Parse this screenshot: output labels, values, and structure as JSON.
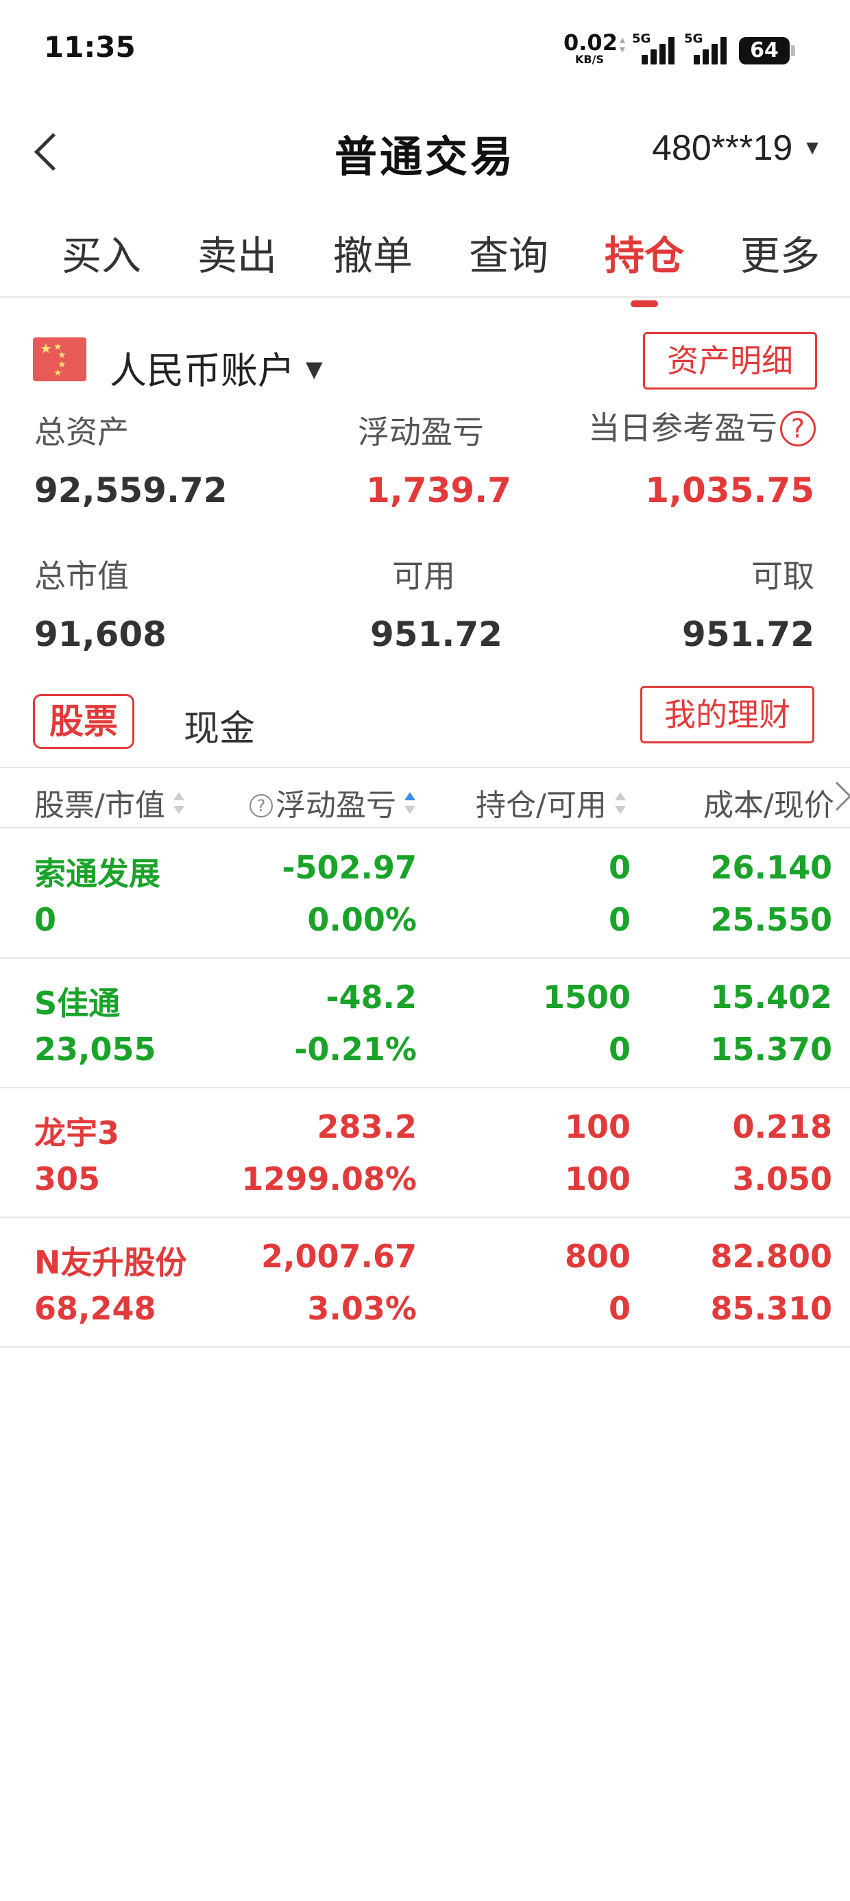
{
  "status_bar": {
    "time": "11:35",
    "net_speed_value": "0.02",
    "net_speed_unit": "KB/S",
    "sim1_label": "5G",
    "sim2_label": "5G",
    "battery": "64"
  },
  "header": {
    "title": "普通交易",
    "account_masked": "480***19",
    "account_dropdown_icon": "▼"
  },
  "tabs": [
    {
      "label": "买入",
      "active": false
    },
    {
      "label": "卖出",
      "active": false
    },
    {
      "label": "撤单",
      "active": false
    },
    {
      "label": "查询",
      "active": false
    },
    {
      "label": "持仓",
      "active": true
    },
    {
      "label": "更多",
      "active": false
    }
  ],
  "account": {
    "label": "人民币账户",
    "dropdown_icon": "▼",
    "flag_icon": "china-flag-icon",
    "asset_detail_button": "资产明细",
    "my_finance_button": "我的理财"
  },
  "metrics": {
    "total_assets_label": "总资产",
    "total_assets_value": "92,559.72",
    "floating_pl_label": "浮动盈亏",
    "floating_pl_value": "1,739.7",
    "daily_ref_pl_label": "当日参考盈亏",
    "daily_ref_pl_value": "1,035.75",
    "help_icon": "?",
    "market_value_label": "总市值",
    "market_value_value": "91,608",
    "available_label": "可用",
    "available_value": "951.72",
    "withdrawable_label": "可取",
    "withdrawable_value": "951.72"
  },
  "sub_tabs": {
    "stock": "股票",
    "cash": "现金"
  },
  "table": {
    "headers": {
      "name_mv": "股票/市值",
      "help_icon": "?",
      "float_pl": "浮动盈亏",
      "position": "持仓/可用",
      "cost_price": "成本/现价"
    },
    "rows": [
      {
        "name": "索通发展",
        "market_value": "0",
        "pl": "-502.97",
        "pl_pct": "0.00%",
        "position": "0",
        "available": "0",
        "cost": "26.140",
        "price": "25.550",
        "trend": "down"
      },
      {
        "name": "S佳通",
        "market_value": "23,055",
        "pl": "-48.2",
        "pl_pct": "-0.21%",
        "position": "1500",
        "available": "0",
        "cost": "15.402",
        "price": "15.370",
        "trend": "down"
      },
      {
        "name": "龙宇3",
        "market_value": "305",
        "pl": "283.2",
        "pl_pct": "1299.08%",
        "position": "100",
        "available": "100",
        "cost": "0.218",
        "price": "3.050",
        "trend": "up"
      },
      {
        "name": "N友升股份",
        "market_value": "68,248",
        "pl": "2,007.67",
        "pl_pct": "3.03%",
        "position": "800",
        "available": "0",
        "cost": "82.800",
        "price": "85.310",
        "trend": "up"
      }
    ]
  },
  "colors": {
    "accent_red": "#e23a3a",
    "loss_green": "#1aa329",
    "sort_active_blue": "#3a8ee6"
  }
}
